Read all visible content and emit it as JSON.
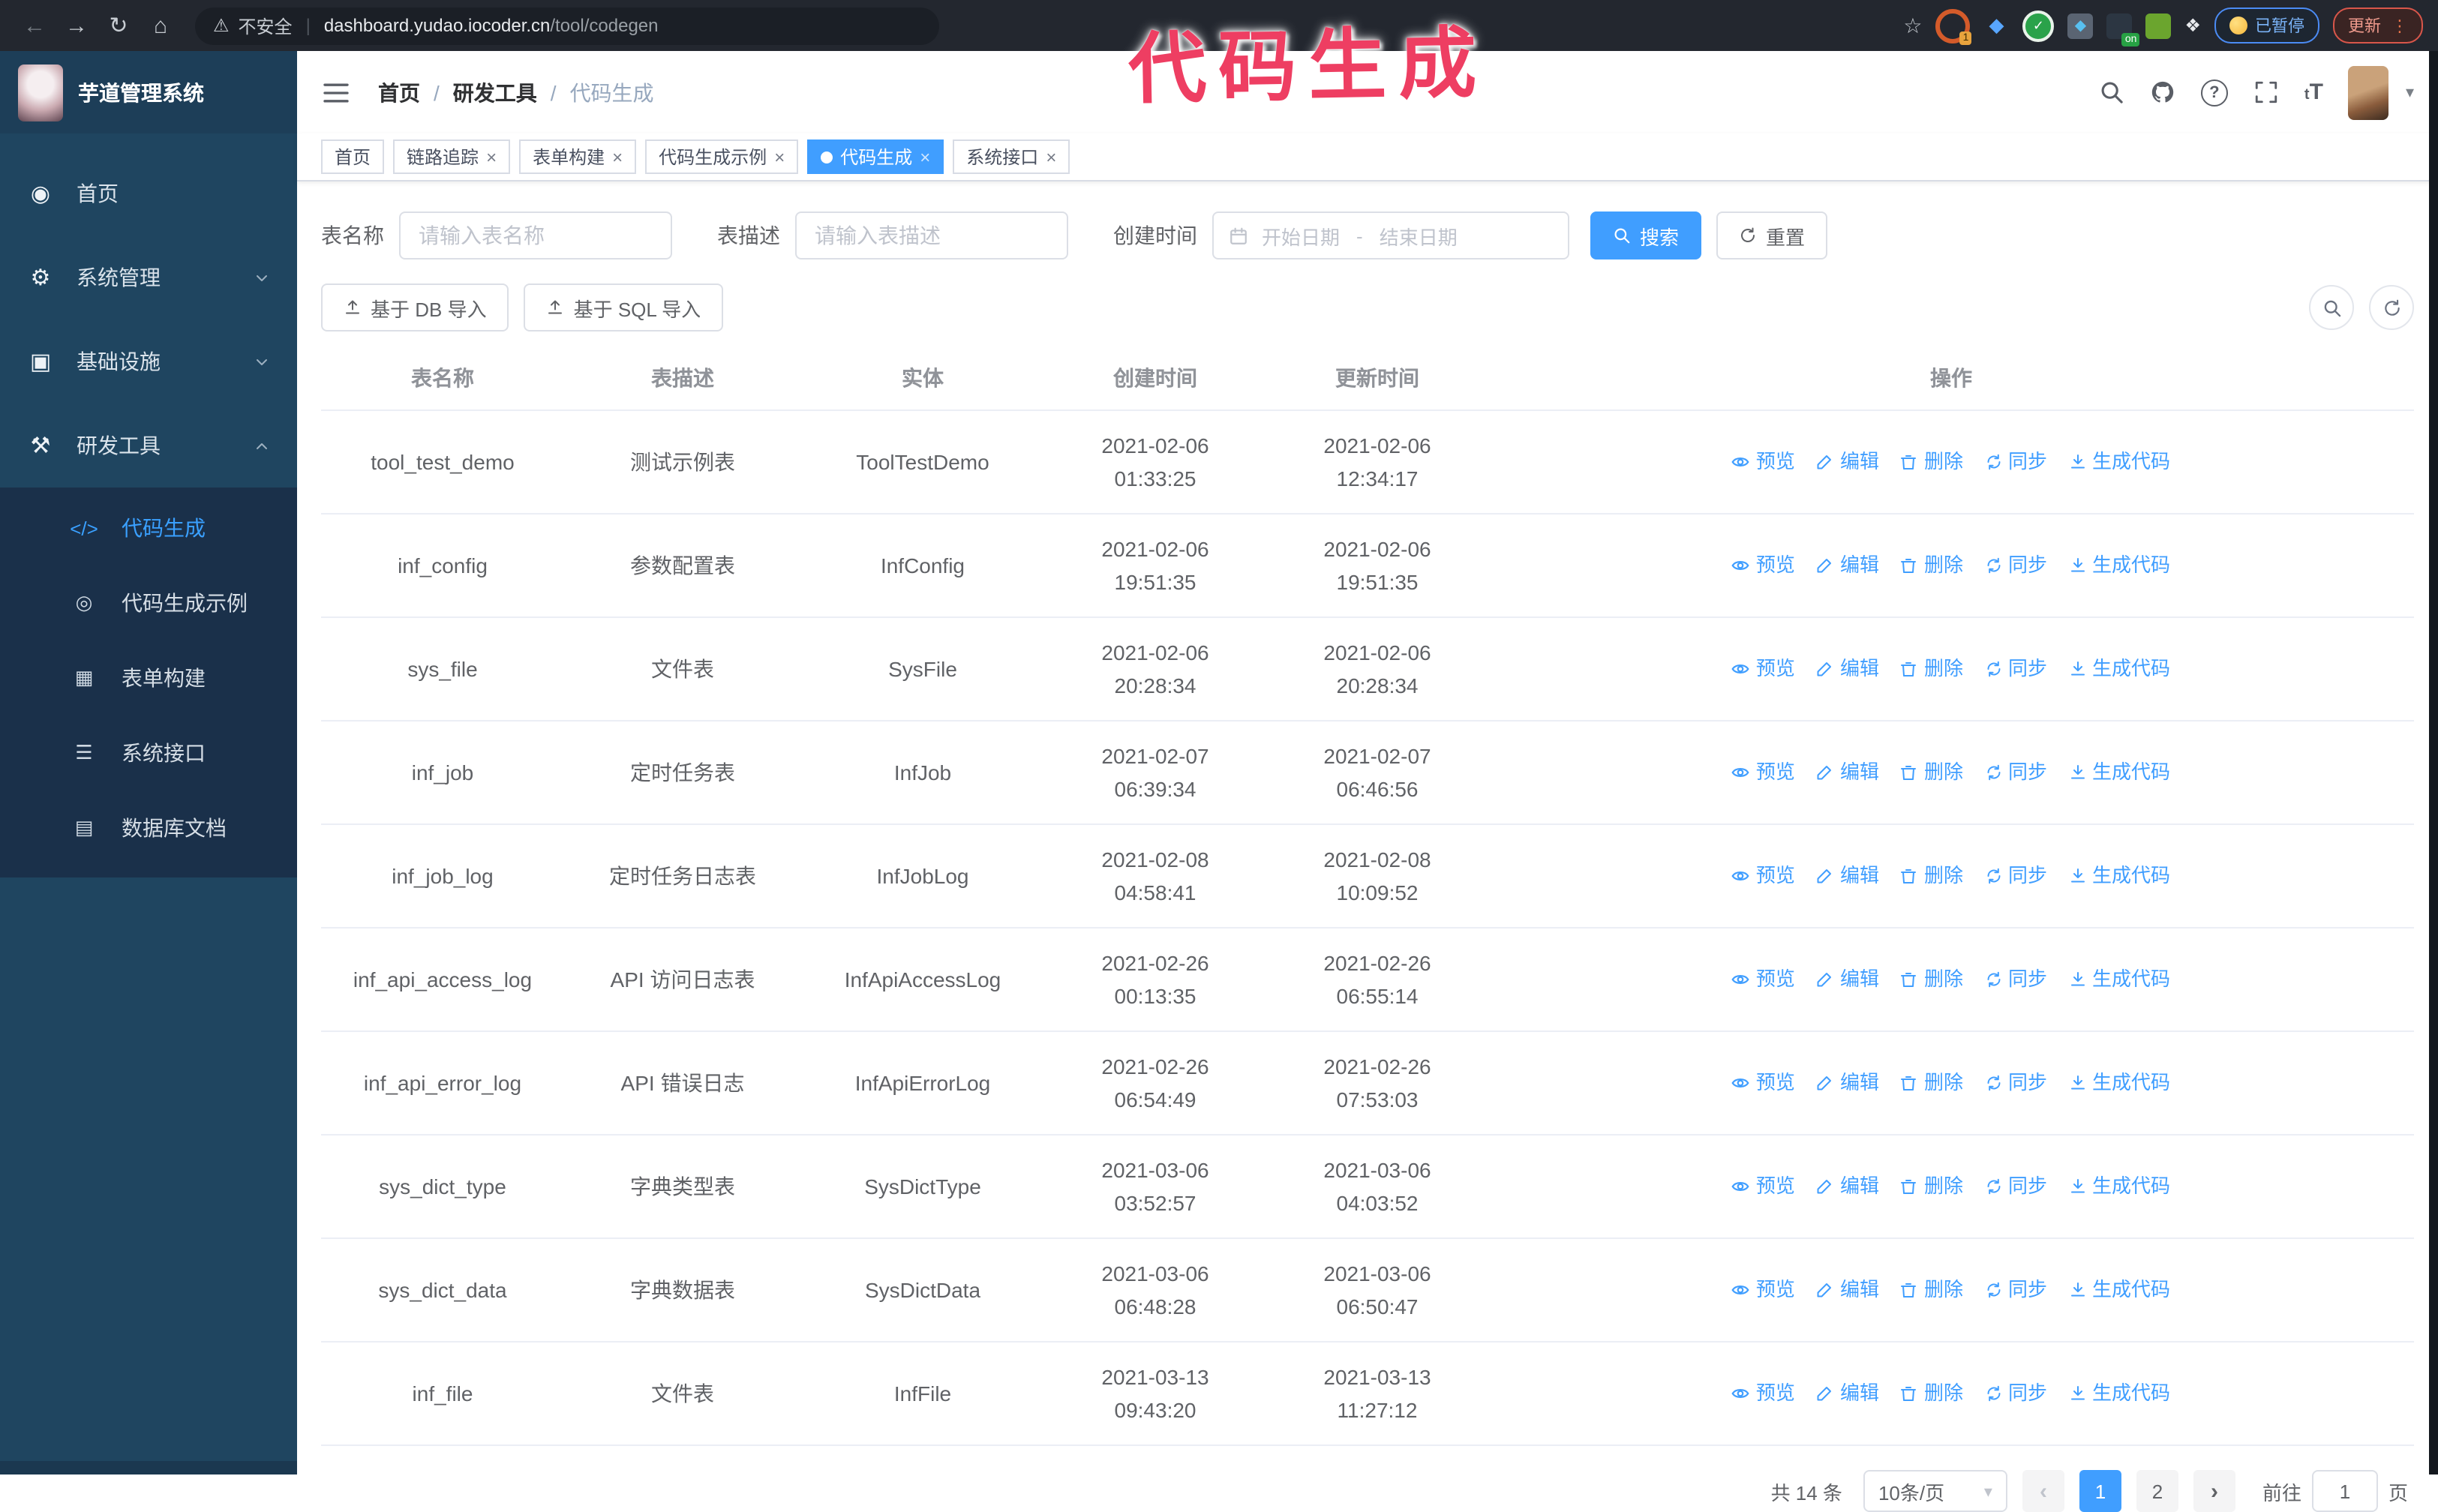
{
  "browser": {
    "security_label": "不安全",
    "url_host": "dashboard.yudao.iocoder.cn",
    "url_path": "/tool/codegen",
    "extension_badge": "1",
    "extension_on_badge": "on",
    "paused_badge": "已暂停",
    "update_button": "更新"
  },
  "annotation": {
    "text": "代码生成",
    "color": "#ee3e62"
  },
  "icons": {
    "back": "←",
    "forward": "→",
    "reload": "↻",
    "home": "⌂",
    "warning": "⚠",
    "star": "☆",
    "puzzle": "❖",
    "gem": "◆",
    "check": "✓",
    "kebab": "⋮",
    "caret_down": "▾",
    "close": "×",
    "accent_blue": "#409eff"
  },
  "sidebar": {
    "logo_title": "芋道管理系统",
    "items": [
      {
        "label": "首页",
        "glyph": "◉",
        "icon_name": "dashboard-icon",
        "chevron": ""
      },
      {
        "label": "系统管理",
        "glyph": "⚙",
        "icon_name": "gear-icon",
        "chevron": "down"
      },
      {
        "label": "基础设施",
        "glyph": "▣",
        "icon_name": "monitor-icon",
        "chevron": "down"
      },
      {
        "label": "研发工具",
        "glyph": "⚒",
        "icon_name": "tools-icon",
        "chevron": "up"
      }
    ],
    "submenu": [
      {
        "label": "代码生成",
        "glyph": "</>",
        "icon_name": "code-icon",
        "active": true
      },
      {
        "label": "代码生成示例",
        "glyph": "◎",
        "icon_name": "example-icon",
        "active": false
      },
      {
        "label": "表单构建",
        "glyph": "▦",
        "icon_name": "form-build-icon",
        "active": false
      },
      {
        "label": "系统接口",
        "glyph": "☰",
        "icon_name": "api-icon",
        "active": false
      },
      {
        "label": "数据库文档",
        "glyph": "▤",
        "icon_name": "db-doc-icon",
        "active": false
      }
    ]
  },
  "header": {
    "breadcrumb": [
      {
        "label": "首页",
        "last": false
      },
      {
        "label": "研发工具",
        "last": false
      },
      {
        "label": "代码生成",
        "last": true
      }
    ],
    "separator": "/",
    "font_size_tool": "tT"
  },
  "tabs": [
    {
      "label": "首页",
      "closable": false,
      "active": false
    },
    {
      "label": "链路追踪",
      "closable": true,
      "active": false
    },
    {
      "label": "表单构建",
      "closable": true,
      "active": false
    },
    {
      "label": "代码生成示例",
      "closable": true,
      "active": false
    },
    {
      "label": "代码生成",
      "closable": true,
      "active": true
    },
    {
      "label": "系统接口",
      "closable": true,
      "active": false
    }
  ],
  "filters": {
    "name_label": "表名称",
    "name_placeholder": "请输入表名称",
    "desc_label": "表描述",
    "desc_placeholder": "请输入表描述",
    "time_label": "创建时间",
    "start_placeholder": "开始日期",
    "range_separator": "-",
    "end_placeholder": "结束日期",
    "search_label": "搜索",
    "reset_label": "重置"
  },
  "toolbar": {
    "db_import_label": "基于 DB 导入",
    "sql_import_label": "基于 SQL 导入"
  },
  "table": {
    "columns": [
      "表名称",
      "表描述",
      "实体",
      "创建时间",
      "更新时间",
      "操作"
    ],
    "actions": [
      {
        "label": "预览",
        "name": "preview",
        "icon": "eye-icon"
      },
      {
        "label": "编辑",
        "name": "edit",
        "icon": "pencil-icon"
      },
      {
        "label": "删除",
        "name": "delete",
        "icon": "trash-icon"
      },
      {
        "label": "同步",
        "name": "sync",
        "icon": "sync-icon"
      },
      {
        "label": "生成代码",
        "name": "generate-code",
        "icon": "download-icon"
      }
    ],
    "rows": [
      {
        "name": "tool_test_demo",
        "desc": "测试示例表",
        "entity": "ToolTestDemo",
        "created": "2021-02-06 01:33:25",
        "updated": "2021-02-06 12:34:17"
      },
      {
        "name": "inf_config",
        "desc": "参数配置表",
        "entity": "InfConfig",
        "created": "2021-02-06 19:51:35",
        "updated": "2021-02-06 19:51:35"
      },
      {
        "name": "sys_file",
        "desc": "文件表",
        "entity": "SysFile",
        "created": "2021-02-06 20:28:34",
        "updated": "2021-02-06 20:28:34"
      },
      {
        "name": "inf_job",
        "desc": "定时任务表",
        "entity": "InfJob",
        "created": "2021-02-07 06:39:34",
        "updated": "2021-02-07 06:46:56"
      },
      {
        "name": "inf_job_log",
        "desc": "定时任务日志表",
        "entity": "InfJobLog",
        "created": "2021-02-08 04:58:41",
        "updated": "2021-02-08 10:09:52"
      },
      {
        "name": "inf_api_access_log",
        "desc": "API 访问日志表",
        "entity": "InfApiAccessLog",
        "created": "2021-02-26 00:13:35",
        "updated": "2021-02-26 06:55:14"
      },
      {
        "name": "inf_api_error_log",
        "desc": "API 错误日志",
        "entity": "InfApiErrorLog",
        "created": "2021-02-26 06:54:49",
        "updated": "2021-02-26 07:53:03"
      },
      {
        "name": "sys_dict_type",
        "desc": "字典类型表",
        "entity": "SysDictType",
        "created": "2021-03-06 03:52:57",
        "updated": "2021-03-06 04:03:52"
      },
      {
        "name": "sys_dict_data",
        "desc": "字典数据表",
        "entity": "SysDictData",
        "created": "2021-03-06 06:48:28",
        "updated": "2021-03-06 06:50:47"
      },
      {
        "name": "inf_file",
        "desc": "文件表",
        "entity": "InfFile",
        "created": "2021-03-13 09:43:20",
        "updated": "2021-03-13 11:27:12"
      }
    ]
  },
  "pagination": {
    "total": "共 14 条",
    "page_size": "10条/页",
    "prev": "‹",
    "next": "›",
    "pages": [
      {
        "label": "1",
        "active": true
      },
      {
        "label": "2",
        "active": false
      }
    ],
    "goto_label": "前往",
    "goto_value": "1",
    "page_label": "页"
  }
}
